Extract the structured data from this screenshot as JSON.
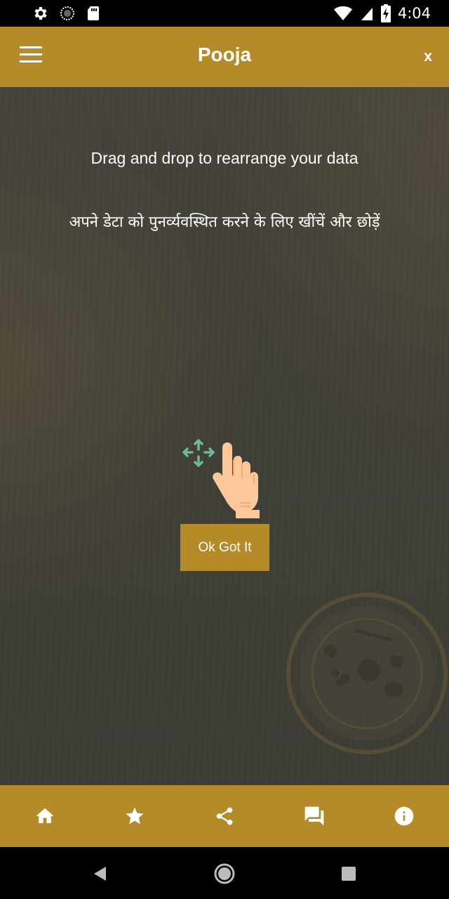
{
  "status_bar": {
    "time": "4:04",
    "icons": [
      "settings-icon",
      "sync-icon",
      "sd-card-icon",
      "wifi-icon",
      "signal-icon",
      "battery-charging-icon"
    ]
  },
  "app_bar": {
    "title": "Pooja",
    "close_label": "x",
    "menu_icon": "hamburger-menu-icon"
  },
  "overlay": {
    "instruction_en": "Drag and drop to rearrange your data",
    "instruction_hi": "अपने डेटा को पुनर्व्यवस्थित करने के लिए खींचें और छोड़ें",
    "gesture_icon": "drag-hand-icon",
    "ok_label": "Ok Got It"
  },
  "bottom_nav": {
    "items": [
      {
        "icon": "home-icon"
      },
      {
        "icon": "star-icon"
      },
      {
        "icon": "share-icon"
      },
      {
        "icon": "messages-icon"
      },
      {
        "icon": "info-icon"
      }
    ]
  },
  "colors": {
    "accent": "#b58b29",
    "background": "#403f38",
    "text": "#ffffff",
    "move_arrows": "#6dbb8f",
    "hand": "#fcc89b"
  }
}
